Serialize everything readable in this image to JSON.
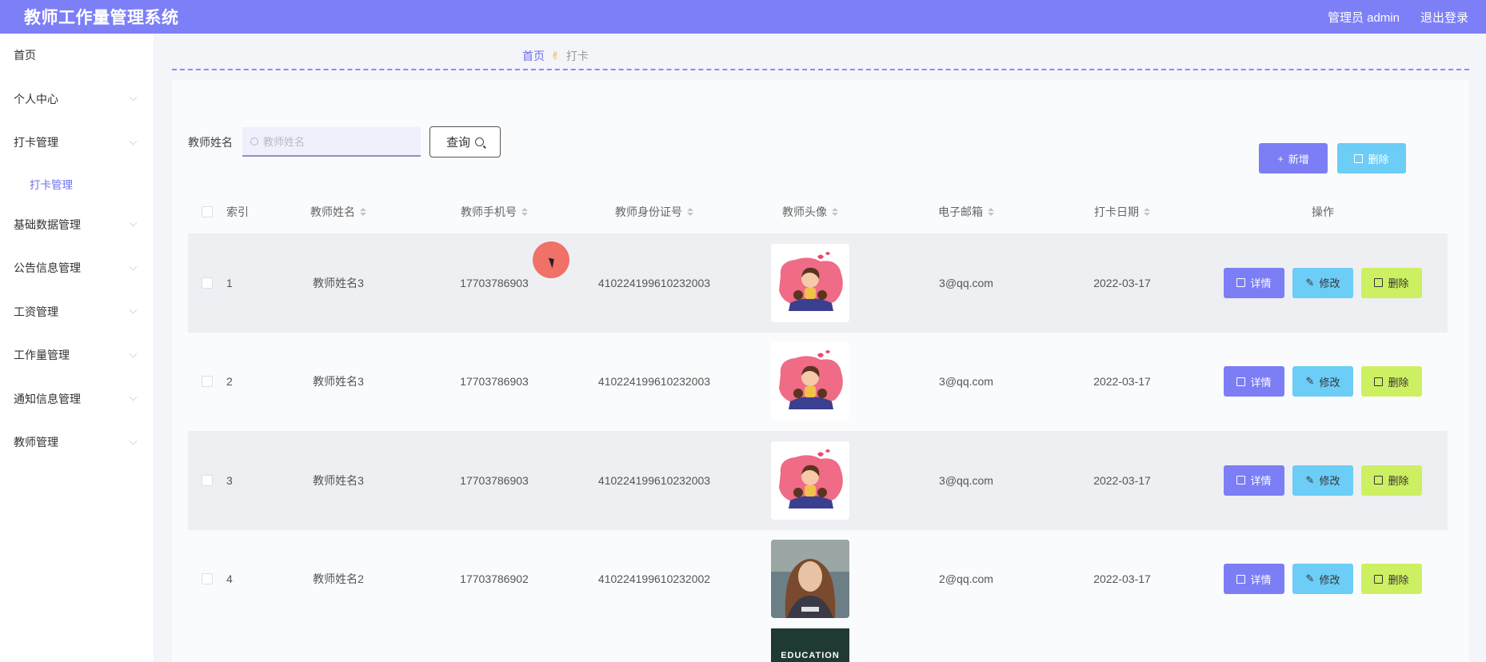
{
  "header": {
    "title": "教师工作量管理系统",
    "user": "管理员 admin",
    "logout": "退出登录"
  },
  "sidebar": {
    "items": [
      {
        "label": "首页",
        "chevron": false
      },
      {
        "label": "个人中心",
        "chevron": true
      },
      {
        "label": "打卡管理",
        "chevron": true
      },
      {
        "label": "打卡管理",
        "sub": true
      },
      {
        "label": "基础数据管理",
        "chevron": true
      },
      {
        "label": "公告信息管理",
        "chevron": true
      },
      {
        "label": "工资管理",
        "chevron": true
      },
      {
        "label": "工作量管理",
        "chevron": true
      },
      {
        "label": "通知信息管理",
        "chevron": true
      },
      {
        "label": "教师管理",
        "chevron": true
      }
    ]
  },
  "breadcrumb": {
    "home": "首页",
    "current": "打卡"
  },
  "search": {
    "label": "教师姓名",
    "placeholder": "教师姓名",
    "button": "查询"
  },
  "toolbar": {
    "add": "新增",
    "delete": "删除"
  },
  "table": {
    "columns": [
      "索引",
      "教师姓名",
      "教师手机号",
      "教师身份证号",
      "教师头像",
      "电子邮箱",
      "打卡日期",
      "操作"
    ],
    "rows": [
      {
        "index": "1",
        "name": "教师姓名3",
        "phone": "17703786903",
        "idcard": "410224199610232003",
        "email": "3@qq.com",
        "date": "2022-03-17",
        "avatar": "cartoon-girl-avatar"
      },
      {
        "index": "2",
        "name": "教师姓名3",
        "phone": "17703786903",
        "idcard": "410224199610232003",
        "email": "3@qq.com",
        "date": "2022-03-17",
        "avatar": "cartoon-girl-avatar"
      },
      {
        "index": "3",
        "name": "教师姓名3",
        "phone": "17703786903",
        "idcard": "410224199610232003",
        "email": "3@qq.com",
        "date": "2022-03-17",
        "avatar": "cartoon-girl-avatar"
      },
      {
        "index": "4",
        "name": "教师姓名2",
        "phone": "17703786902",
        "idcard": "410224199610232002",
        "email": "2@qq.com",
        "date": "2022-03-17",
        "avatar": "photo-avatar"
      }
    ],
    "ops": {
      "detail": "详情",
      "edit": "修改",
      "delete": "删除"
    }
  },
  "partial_row": {
    "avatar_text": "EDUCATION"
  },
  "colors": {
    "topbar": "#7d7ff7",
    "primary": "#7c7ef5",
    "info": "#6ccdf6",
    "warn": "#cdf063"
  }
}
